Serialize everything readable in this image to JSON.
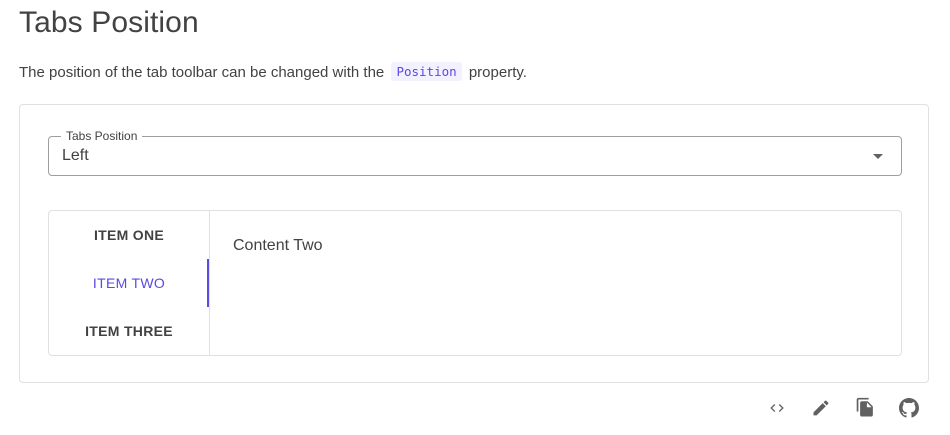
{
  "header": {
    "title": "Tabs Position",
    "description_before": "The position of the tab toolbar can be changed with the",
    "code": "Position",
    "description_after": "property."
  },
  "select": {
    "label": "Tabs Position",
    "value": "Left"
  },
  "tabs": {
    "items": [
      {
        "label": "ITEM ONE"
      },
      {
        "label": "ITEM TWO"
      },
      {
        "label": "ITEM THREE"
      }
    ],
    "active_index": 1,
    "content": "Content Two"
  },
  "actions": [
    {
      "icon": "code-icon"
    },
    {
      "icon": "edit-icon"
    },
    {
      "icon": "copy-icon"
    },
    {
      "icon": "github-icon"
    }
  ],
  "colors": {
    "primary": "#594ae2",
    "text": "#424242",
    "border": "#e0e0e0"
  }
}
